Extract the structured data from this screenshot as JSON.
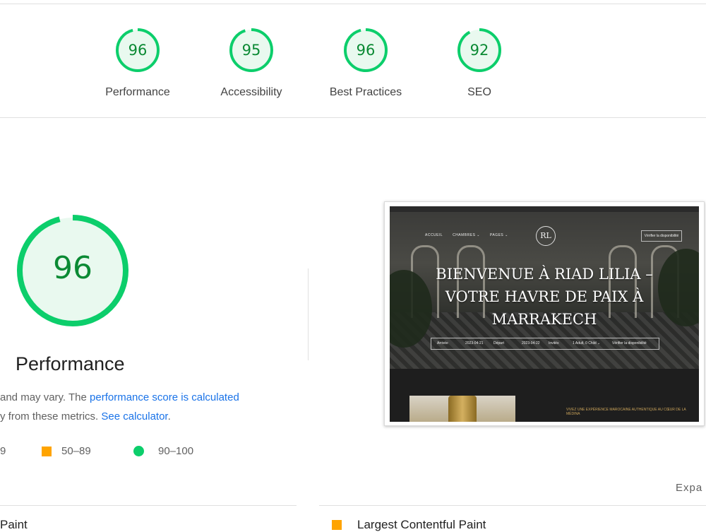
{
  "scores": [
    {
      "label": "Performance",
      "value": "96",
      "score": 96
    },
    {
      "label": "Accessibility",
      "value": "95",
      "score": 95
    },
    {
      "label": "Best Practices",
      "value": "96",
      "score": 96
    },
    {
      "label": "SEO",
      "value": "92",
      "score": 92
    }
  ],
  "performance": {
    "score": "96",
    "score_value": 96,
    "title": "Performance",
    "desc_line1_prefix": "and may vary. The ",
    "desc_line1_link": "performance score is calculated",
    "desc_line2_prefix": "y from these metrics. ",
    "desc_line2_link": "See calculator",
    "desc_line2_suffix": "."
  },
  "legend": {
    "fail": "9",
    "average": "50–89",
    "pass": "90–100"
  },
  "screenshot": {
    "logo": "RL",
    "nav": [
      "ACCUEIL",
      "CHAMBRES ⌄",
      "PAGES ⌄"
    ],
    "nav_button": "Vérifier la disponibilité",
    "hero_title_lines": [
      "BIENVENUE À RIAD LILIA –",
      "VOTRE HAVRE DE PAIX À",
      "MARRAKECH"
    ],
    "booking": [
      "Arrivée",
      "2023-04-21",
      "Départ",
      "2023-04-22",
      "Invités",
      "1 Adult, 0 Child ⌄",
      "Vérifier la disponibilité"
    ],
    "bottom_text": "VIVEZ UNE EXPÉRIENCE MAROCAINE AUTHENTIQUE AU CŒUR DE LA MÉDINA"
  },
  "expand_label": "Expa",
  "metrics": {
    "left": "Paint",
    "right": "Largest Contentful Paint"
  },
  "colors": {
    "pass": "#0cce6b",
    "pass_text": "#0b8a34",
    "average": "#ffa400",
    "link": "#1a73e8"
  }
}
